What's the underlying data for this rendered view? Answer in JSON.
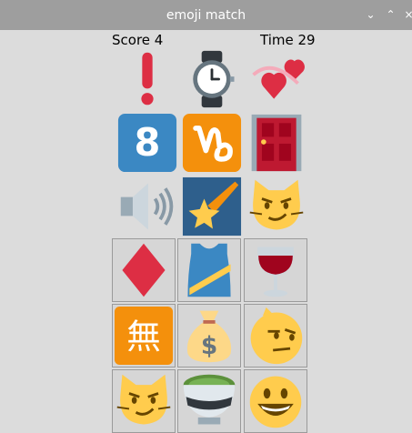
{
  "window": {
    "title": "emoji match",
    "buttons": {
      "minimize": "⌄",
      "maximize": "⌃",
      "close": "×"
    }
  },
  "hud": {
    "score_label": "Score  4",
    "time_label": "Time 29"
  },
  "board": {
    "columns": 3,
    "rows": [
      [
        "exclamation-mark",
        "wristwatch",
        "two-hearts"
      ],
      [
        "keycap-eight",
        "capricorn",
        "door"
      ],
      [
        "speaker",
        "shooting-star",
        "cat-smirk"
      ],
      [
        "diamond-suit",
        "running-shirt",
        "wine-glass"
      ],
      [
        "japanese-free-of-charge",
        "money-bag",
        "unamused-face"
      ],
      [
        "cat-smirk",
        "matcha-tea",
        "grinning-face"
      ]
    ],
    "glyphs": {
      "keycap-eight": "8",
      "japanese-free-of-charge": "無",
      "money-bag": "$"
    }
  },
  "colors": {
    "titlebar": "#9e9e9e",
    "background": "#dcdcdc",
    "tile_blue": "#3b88c3",
    "tile_orange": "#f4900c",
    "red": "#dd2e44",
    "yellow": "#ffcc4d"
  }
}
